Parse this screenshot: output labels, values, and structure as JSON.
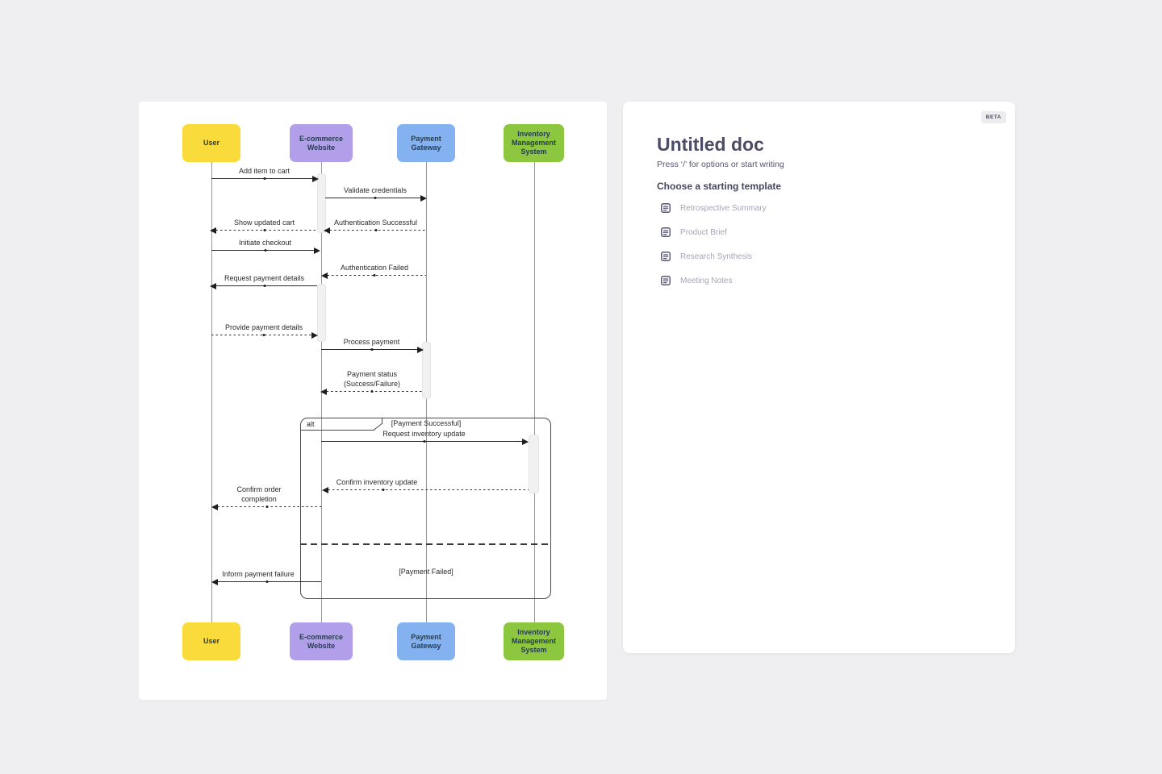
{
  "app": {
    "background_color": "#EFEFF1",
    "card_color": "#FFFFFF"
  },
  "diagram": {
    "actors": [
      {
        "label": "User",
        "color": "#FADB3C"
      },
      {
        "label": "E-commerce Website",
        "color": "#B1A0E9"
      },
      {
        "label": "Payment Gateway",
        "color": "#84B2F1"
      },
      {
        "label": "Inventory Management System",
        "color": "#8DC63F"
      }
    ],
    "messages": [
      {
        "label": "Add item to cart",
        "from": "User",
        "to": "E-commerce Website",
        "line": "solid"
      },
      {
        "label": "Validate credentials",
        "from": "E-commerce Website",
        "to": "Payment Gateway",
        "line": "solid"
      },
      {
        "label": "Show updated cart",
        "from": "E-commerce Website",
        "to": "User",
        "line": "dashed"
      },
      {
        "label": "Authentication Successful",
        "from": "Payment Gateway",
        "to": "E-commerce Website",
        "line": "dashed"
      },
      {
        "label": "Initiate checkout",
        "from": "User",
        "to": "E-commerce Website",
        "line": "solid"
      },
      {
        "label": "Authentication Failed",
        "from": "Payment Gateway",
        "to": "E-commerce Website",
        "line": "dashed"
      },
      {
        "label": "Request payment details",
        "from": "E-commerce Website",
        "to": "User",
        "line": "solid"
      },
      {
        "label": "Provide payment details",
        "from": "User",
        "to": "E-commerce Website",
        "line": "dashed"
      },
      {
        "label": "Process payment",
        "from": "E-commerce Website",
        "to": "Payment Gateway",
        "line": "solid"
      },
      {
        "label": "Payment status",
        "label2": "(Success/Failure)",
        "from": "Payment Gateway",
        "to": "E-commerce Website",
        "line": "dashed"
      },
      {
        "label": "Request inventory update",
        "from": "E-commerce Website",
        "to": "Inventory Management System",
        "line": "solid"
      },
      {
        "label": "Confirm inventory update",
        "from": "Inventory Management System",
        "to": "E-commerce Website",
        "line": "dashed"
      },
      {
        "label": "Confirm order",
        "label2": "completion",
        "from": "E-commerce Website",
        "to": "User",
        "line": "dashed"
      },
      {
        "label": "Inform payment failure",
        "from": "E-commerce Website",
        "to": "User",
        "line": "solid"
      }
    ],
    "alt": {
      "operator": "alt",
      "guard_success": "[Payment Successful]",
      "guard_failed": "[Payment Failed]"
    }
  },
  "doc": {
    "beta": "BETA",
    "title": "Untitled doc",
    "hint": "Press ‘/’ for options or start writing",
    "templates_heading": "Choose a starting template",
    "templates": [
      "Retrospective Summary",
      "Product Brief",
      "Research Synthesis",
      "Meeting Notes"
    ]
  }
}
